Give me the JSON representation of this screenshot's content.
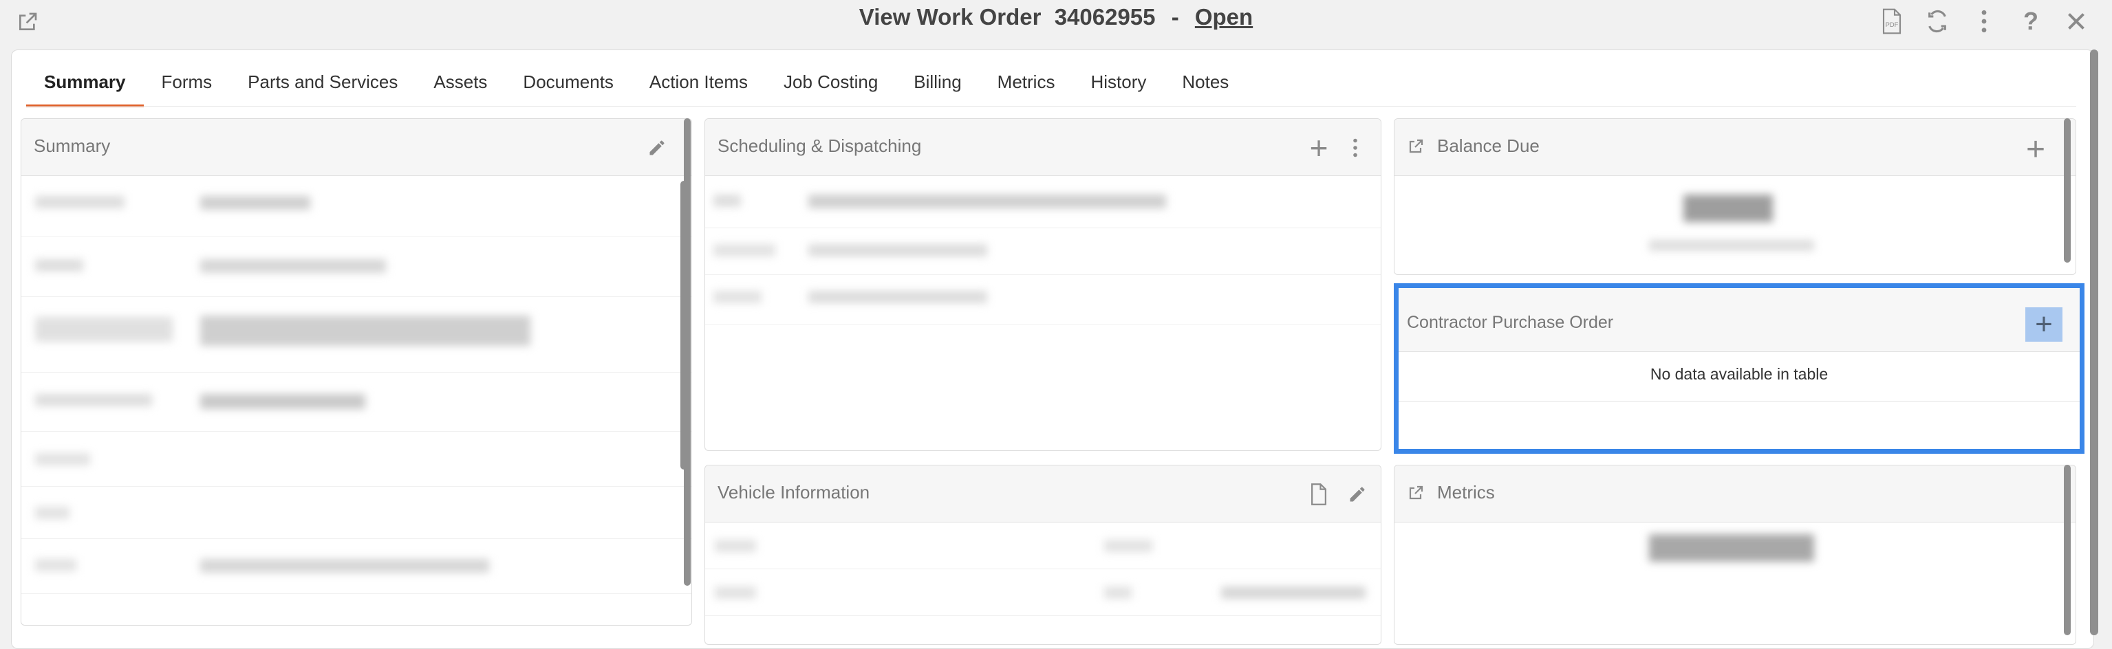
{
  "title": {
    "prefix": "View Work Order",
    "number": "34062955",
    "separator": "-",
    "status": "Open"
  },
  "toolbar": {
    "icons": [
      "external-link-icon",
      "pdf-icon",
      "refresh-icon",
      "kebab-menu-icon",
      "help-icon",
      "close-icon"
    ]
  },
  "tabs": [
    "Summary",
    "Forms",
    "Parts and Services",
    "Assets",
    "Documents",
    "Action Items",
    "Job Costing",
    "Billing",
    "Metrics",
    "History",
    "Notes"
  ],
  "summary_panel": {
    "title": "Summary"
  },
  "scheduling_panel": {
    "title": "Scheduling & Dispatching"
  },
  "vehicle_panel": {
    "title": "Vehicle Information"
  },
  "balance_panel": {
    "title": "Balance Due"
  },
  "cpo_panel": {
    "title": "Contractor Purchase Order",
    "empty_text": "No data available in table"
  },
  "metrics_panel": {
    "title": "Metrics"
  },
  "colors": {
    "accent_tab": "#e0612a",
    "highlight": "#3a86e8"
  }
}
